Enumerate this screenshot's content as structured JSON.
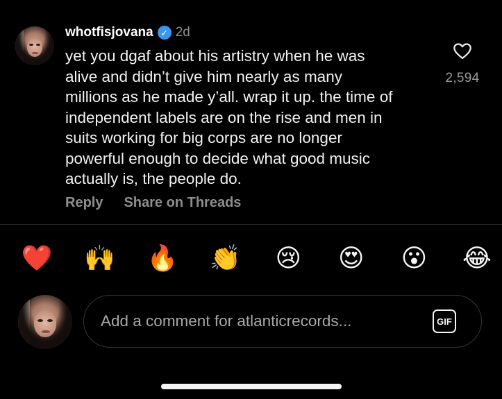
{
  "comment": {
    "username": "whotfisjovana",
    "verified": true,
    "age": "2d",
    "text": "yet you dgaf about his artistry when he was\nalive and didn’t give him nearly as many\nmillions as he made y’all. wrap it up. the time of\nindependent labels are on the rise and men in\nsuits working for big corps are no longer\npowerful enough to decide what good music\nactually is, the people do.",
    "like_count": "2,594",
    "actions": {
      "reply": "Reply",
      "share": "Share on Threads"
    }
  },
  "reactions": [
    {
      "name": "red-heart",
      "glyph": "❤️"
    },
    {
      "name": "raising-hands",
      "glyph": "🙌"
    },
    {
      "name": "fire",
      "glyph": "🔥"
    },
    {
      "name": "clapping-hands",
      "glyph": "👏"
    },
    {
      "name": "crying-face",
      "glyph": "😢"
    },
    {
      "name": "heart-eyes",
      "glyph": "😍"
    },
    {
      "name": "surprised-face",
      "glyph": "😮"
    },
    {
      "name": "tears-of-joy",
      "glyph": "😂"
    }
  ],
  "composer": {
    "placeholder": "Add a comment for atlanticrecords...",
    "gif_label": "GIF"
  },
  "colors": {
    "background": "#000000",
    "verified": "#3897f0",
    "muted_text": "#8e8e8e"
  },
  "icons": {
    "verified": "verified-badge-icon",
    "like": "heart-outline-icon",
    "gif": "gif-icon"
  }
}
